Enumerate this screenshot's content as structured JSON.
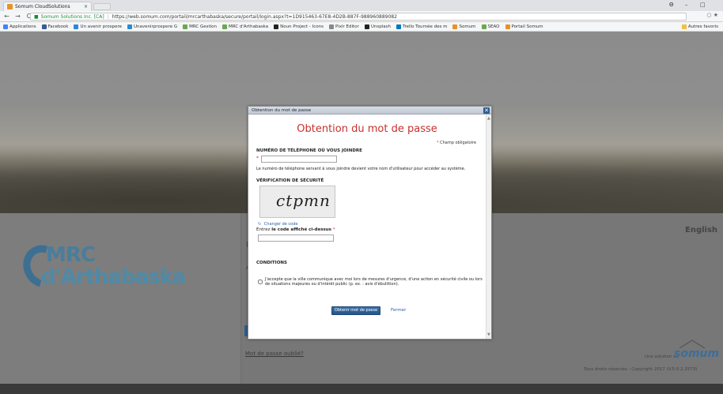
{
  "browser": {
    "tab_title": "Somum CloudSolutions",
    "tab_close": "×",
    "window_controls": {
      "user": "Θ",
      "minimize": "–",
      "maximize": "□"
    },
    "nav": {
      "back": "←",
      "forward": "→",
      "reload": "C"
    },
    "secure_label": "Somum Solutions Inc. [CA]",
    "url": "https://web.somum.com/portail/mrcarthabaska/secure/portail/login.aspx?t=1D915463-67E8-4D2B-887F-988960889082",
    "bookmarks": [
      {
        "label": "Applications",
        "color": "#4285f4"
      },
      {
        "label": "Facebook",
        "color": "#3b5998"
      },
      {
        "label": "Un avenir prospere",
        "color": "#2a8ad4"
      },
      {
        "label": "Unavenirprospere G",
        "color": "#2a8ad4"
      },
      {
        "label": "MRC Gestion",
        "color": "#6aa84f"
      },
      {
        "label": "MRC d'Arthabaska",
        "color": "#6aa84f"
      },
      {
        "label": "Noun Project - Icons",
        "color": "#222222"
      },
      {
        "label": "Pixlr Editor",
        "color": "#888888"
      },
      {
        "label": "Unsplash",
        "color": "#222222"
      },
      {
        "label": "Trello Tournée des m",
        "color": "#0079bf"
      },
      {
        "label": "Somum",
        "color": "#e8922c"
      },
      {
        "label": "SEAO",
        "color": "#6aa84f"
      },
      {
        "label": "Portail Somum",
        "color": "#e8922c"
      }
    ],
    "other_bookmarks": "Autres favoris"
  },
  "page": {
    "language_link": "English",
    "forgot_password_link": "Mot de passe oublié?",
    "bg_fragments": {
      "e": "E",
      "a": "A"
    },
    "solution_text": "Une solution de",
    "brand": "somum",
    "copyright": "Tous droits réservés - Copyright 2017 (V.5.0.2.2573)",
    "logo_line1": "MRC",
    "logo_line2": "d'Arthabaska"
  },
  "modal": {
    "window_title": "Obtention du mot de passe",
    "close_symbol": "✕",
    "heading": "Obtention du mot de passe",
    "required_note": "Champ obligatoire",
    "required_star": "*",
    "phone_label": "NUMÉRO DE TÉLÉPHONE OÙ VOUS JOINDRE",
    "phone_value": "",
    "phone_help": "Le numéro de téléphone servant à vous joindre devient votre nom d'utilisateur pour accéder au système.",
    "security_label": "VÉRIFICATION DE SÉCURITÉ",
    "captcha_text": "ctpmn",
    "refresh_icon": "↻",
    "change_code": "Changer de code",
    "enter_code_prefix": "Entrez",
    "enter_code_bold": "le code affiché ci-dessus",
    "code_value": "",
    "conditions_label": "CONDITIONS",
    "conditions_text": "J'accepte que la ville communique avec moi lors de mesures d'urgence, d'une action en sécurité civile ou lors de situations majeures ou d'intérêt public (p. ex. : avis d'ébullition).",
    "conditions_checked": false,
    "submit_label": "Obtenir mot de passe",
    "close_label": "Fermer"
  }
}
